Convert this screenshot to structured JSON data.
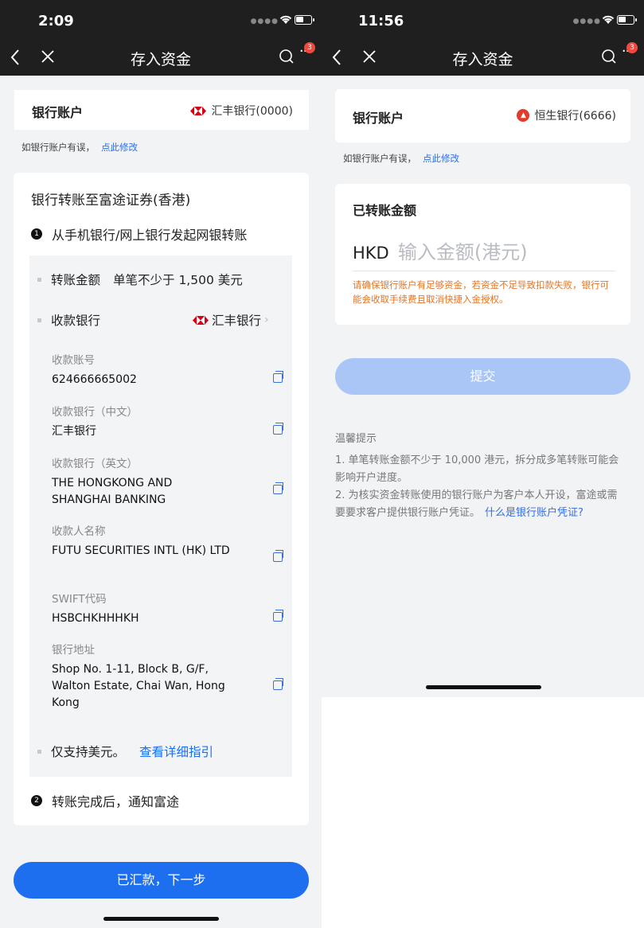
{
  "left": {
    "status_time": "2:09",
    "nav_title": "存入资金",
    "badge_count": "3",
    "bank_label": "银行账户",
    "bank_value": "汇丰银行(0000)",
    "hint_text": "如银行账户有误，",
    "hint_link": "点此修改",
    "section_title": "银行转账至富途证券(香港)",
    "step1_num": "1",
    "step1_text": "从手机银行/网上银行发起网银转账",
    "amount_label": "转账金额",
    "amount_value": "单笔不少于 1,500 美元",
    "recv_bank_label": "收款银行",
    "recv_bank_value": "汇丰银行",
    "fields": [
      {
        "label": "收款账号",
        "value": "624666665002"
      },
      {
        "label": "收款银行（中文）",
        "value": "汇丰银行"
      },
      {
        "label": "收款银行（英文）",
        "value": "THE HONGKONG AND SHANGHAI BANKING"
      },
      {
        "label": "收款人名称",
        "value": "FUTU SECURITIES INTL (HK) LTD"
      },
      {
        "label": "SWIFT代码",
        "value": "HSBCHKHHHKH"
      },
      {
        "label": "银行地址",
        "value": "Shop No. 1-11, Block B, G/F, Walton Estate, Chai Wan, Hong Kong"
      }
    ],
    "usd_only": "仅支持美元。",
    "guide_link": "查看详细指引",
    "step2_num": "2",
    "step2_text": "转账完成后，通知富途",
    "submit": "已汇款，下一步",
    "accent": "#1e6ff0"
  },
  "right": {
    "status_time": "11:56",
    "nav_title": "存入资金",
    "badge_count": "3",
    "bank_label": "银行账户",
    "bank_value": "恒生银行(6666)",
    "hint_text": "如银行账户有误，",
    "hint_link": "点此修改",
    "amount_title": "已转账金额",
    "currency": "HKD",
    "amount_placeholder": "输入金额(港元)",
    "warning": "请确保银行账户有足够资金，若资金不足导致扣款失败，银行可能会收取手续费且取消快捷入金授权。",
    "submit": "提交",
    "tips_title": "温馨提示",
    "tip1": "1. 单笔转账金额不少于 10,000 港元，拆分成多笔转账可能会影响开户进度。",
    "tip2": "2. 为核实资金转账使用的银行账户为客户本人开设，富途或需要要求客户提供银行账户凭证。",
    "tip2_link": "什么是银行账户凭证?",
    "warning_color": "#e0762a",
    "disabled_btn_color": "#a9c6f6"
  }
}
